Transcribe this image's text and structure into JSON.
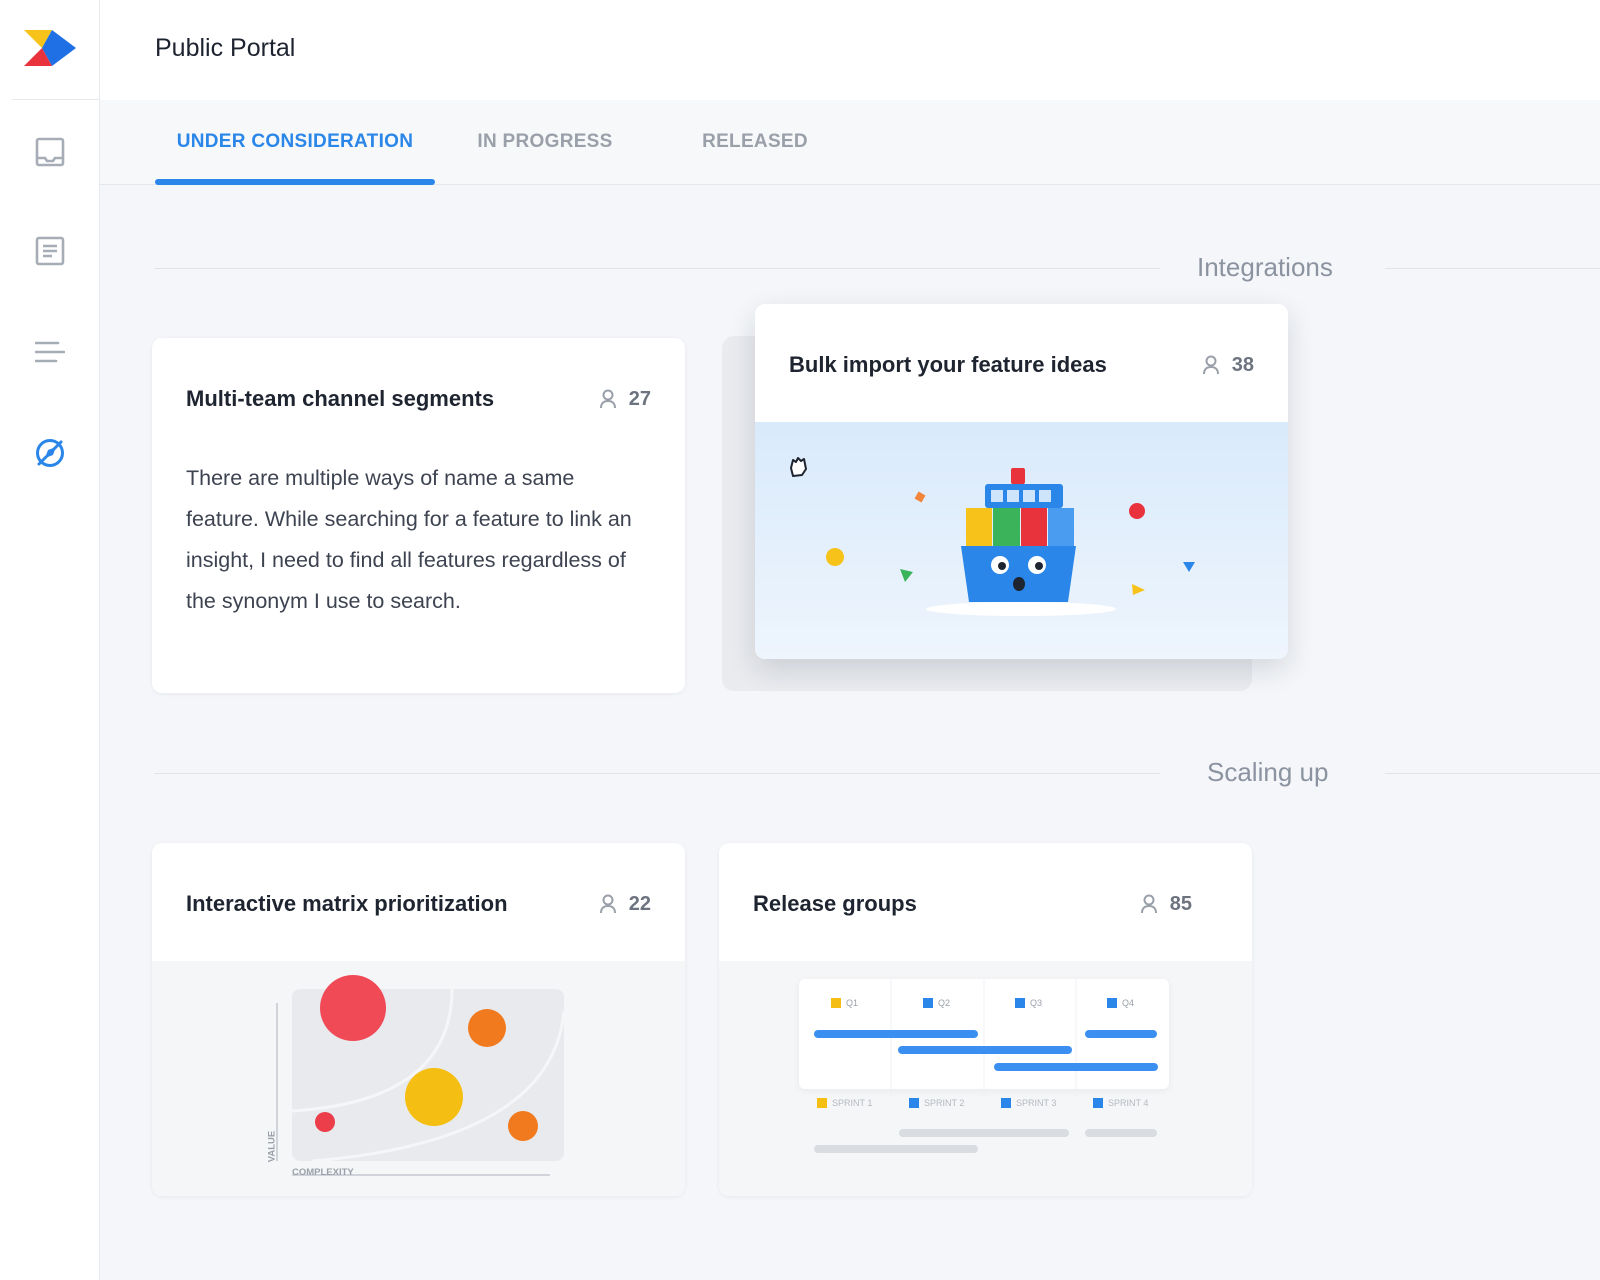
{
  "app": {
    "title": "Public Portal"
  },
  "colors": {
    "accent": "#2a86e8",
    "muted": "#9aa0a9"
  },
  "sidebar": {
    "logo": "brand-logo",
    "items": [
      {
        "icon": "inbox-icon"
      },
      {
        "icon": "document-icon"
      },
      {
        "icon": "lines-icon"
      },
      {
        "icon": "compass-icon",
        "active": true
      }
    ]
  },
  "tabs": [
    {
      "label": "UNDER CONSIDERATION",
      "active": true
    },
    {
      "label": "IN PROGRESS"
    },
    {
      "label": "RELEASED"
    }
  ],
  "sections": [
    {
      "label": "Integrations",
      "cards": [
        {
          "title": "Multi-team channel segments",
          "votes": "27",
          "description": "There are multiple ways of name a same feature. While searching for a feature to link an insight, I need to find all features regardless of the synonym I use to search."
        },
        {
          "title": "Bulk import your feature ideas",
          "votes": "38",
          "illustration": "cargo-ship"
        }
      ]
    },
    {
      "label": "Scaling up",
      "cards": [
        {
          "title": "Interactive matrix prioritization",
          "votes": "22",
          "illustration": "matrix",
          "x_axis": "COMPLEXITY",
          "y_axis": "VALUE"
        },
        {
          "title": "Release groups",
          "votes": "85",
          "illustration": "timeline",
          "quarters": [
            "Q1",
            "Q2",
            "Q3",
            "Q4"
          ],
          "sprints": [
            "SPRINT 1",
            "SPRINT 2",
            "SPRINT 3",
            "SPRINT 4"
          ]
        }
      ]
    }
  ]
}
